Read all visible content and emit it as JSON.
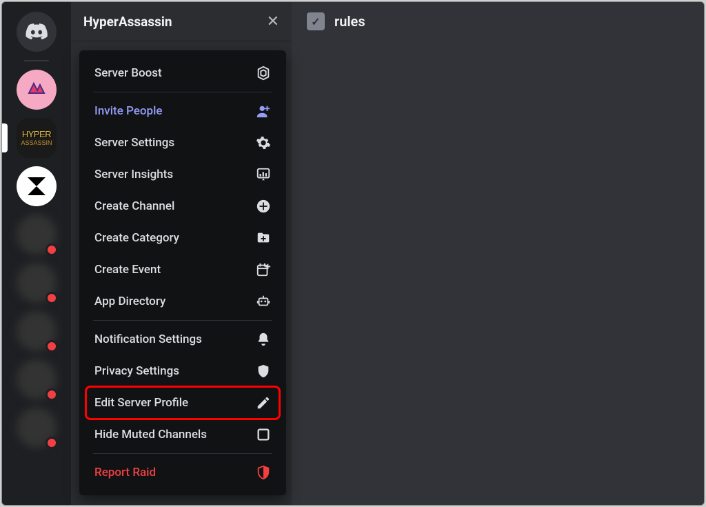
{
  "server": {
    "name": "HyperAssassin"
  },
  "channel": {
    "name": "rules",
    "icon": "rules-checkbox-icon"
  },
  "dropdown": {
    "server_boost": "Server Boost",
    "invite_people": "Invite People",
    "server_settings": "Server Settings",
    "server_insights": "Server Insights",
    "create_channel": "Create Channel",
    "create_category": "Create Category",
    "create_event": "Create Event",
    "app_directory": "App Directory",
    "notification_settings": "Notification Settings",
    "privacy_settings": "Privacy Settings",
    "edit_server_profile": "Edit Server Profile",
    "hide_muted_channels": "Hide Muted Channels",
    "report_raid": "Report Raid"
  },
  "guilds": {
    "home": "discord-home",
    "server1": "pink-server",
    "server2": "HyperAssassin",
    "server3": "bw-server"
  },
  "colors": {
    "accent_invite": "#949cf7",
    "danger": "#f23f42",
    "highlight_outline": "#ff0000"
  }
}
